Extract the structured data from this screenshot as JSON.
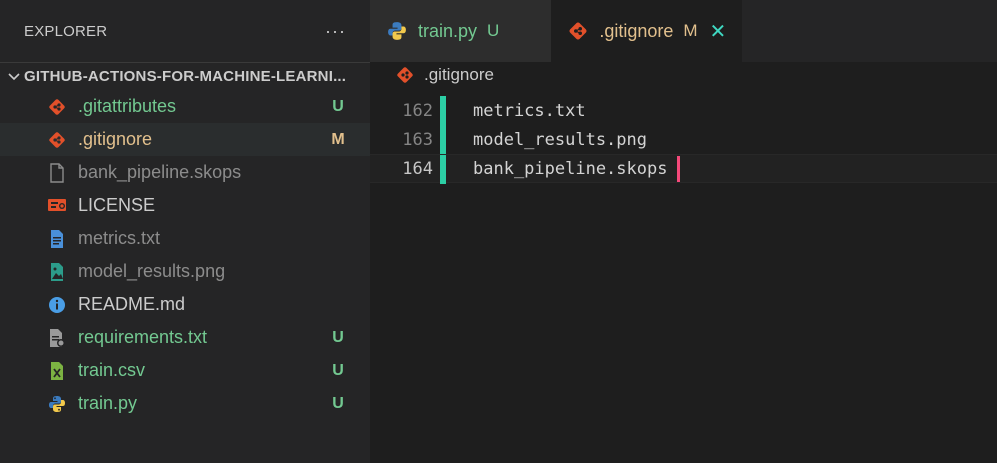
{
  "sidebar": {
    "title": "EXPLORER",
    "more_label": "···",
    "section_label": "GITHUB-ACTIONS-FOR-MACHINE-LEARNI...",
    "files": [
      {
        "name": ".gitattributes",
        "badge": "U",
        "status": "untracked",
        "icon": "git-icon"
      },
      {
        "name": ".gitignore",
        "badge": "M",
        "status": "modified",
        "icon": "git-icon"
      },
      {
        "name": "bank_pipeline.skops",
        "badge": "",
        "status": "ignored",
        "icon": "file-icon"
      },
      {
        "name": "LICENSE",
        "badge": "",
        "status": "normal",
        "icon": "license-icon"
      },
      {
        "name": "metrics.txt",
        "badge": "",
        "status": "ignored",
        "icon": "text-file-icon"
      },
      {
        "name": "model_results.png",
        "badge": "",
        "status": "ignored",
        "icon": "image-file-icon"
      },
      {
        "name": "README.md",
        "badge": "",
        "status": "normal",
        "icon": "info-icon"
      },
      {
        "name": "requirements.txt",
        "badge": "U",
        "status": "untracked",
        "icon": "requirements-icon"
      },
      {
        "name": "train.csv",
        "badge": "U",
        "status": "untracked",
        "icon": "csv-icon"
      },
      {
        "name": "train.py",
        "badge": "U",
        "status": "untracked",
        "icon": "python-icon"
      }
    ]
  },
  "tabs": [
    {
      "name": "train.py",
      "badge": "U",
      "icon": "python-icon",
      "active": false
    },
    {
      "name": ".gitignore",
      "badge": "M",
      "icon": "git-icon",
      "active": true,
      "close": "✕"
    }
  ],
  "breadcrumb": {
    "file": ".gitignore"
  },
  "code": [
    {
      "num": "162",
      "text": "metrics.txt"
    },
    {
      "num": "163",
      "text": "model_results.png"
    },
    {
      "num": "164",
      "text": "bank_pipeline.skops",
      "current": true
    }
  ],
  "colors": {
    "git": "#e2502a",
    "untracked": "#73c991",
    "modified": "#e2c08d",
    "gutter_added": "#2ccfa5",
    "cursor": "#f5497a"
  }
}
